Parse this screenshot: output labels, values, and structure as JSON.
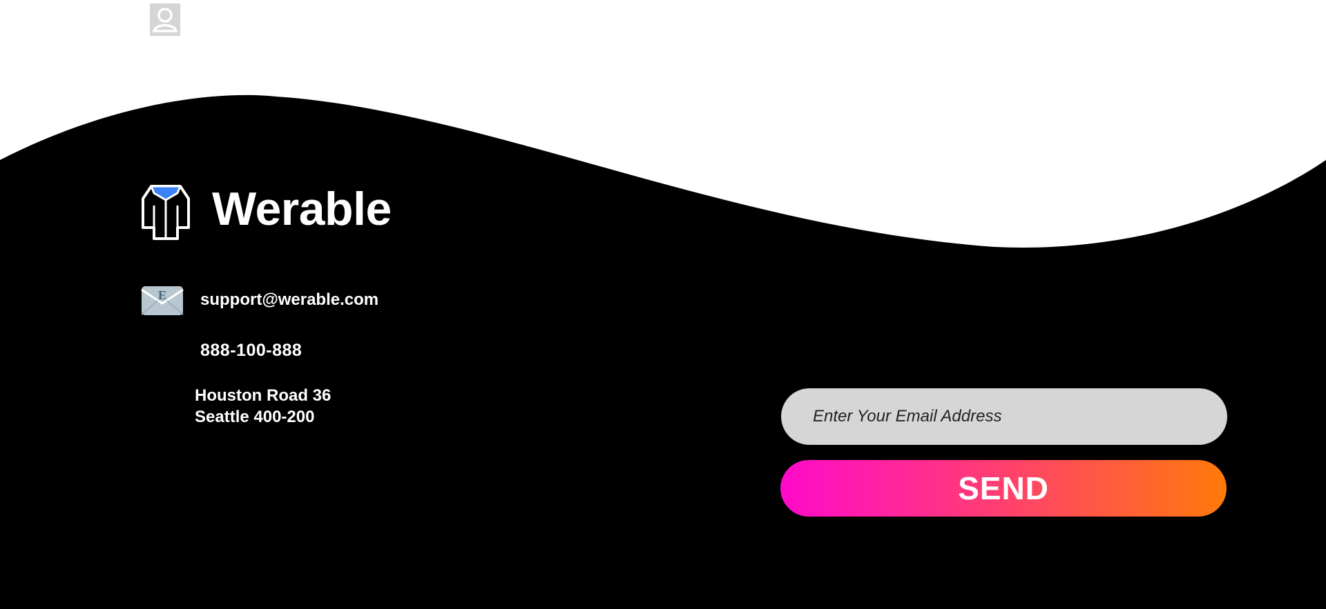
{
  "header": {
    "avatar_icon": "user-avatar-icon"
  },
  "footer": {
    "brand": {
      "logo_icon": "shirt-icon",
      "name": "Werable",
      "accent_color": "#3b82f6"
    },
    "contact": {
      "email_icon": "envelope-icon",
      "email": "support@werable.com",
      "phone": "888-100-888",
      "address_line1": "Houston Road 36",
      "address_line2": "Seattle 400-200"
    },
    "newsletter": {
      "email_placeholder": "Enter Your Email Address",
      "email_value": "",
      "send_label": "SEND",
      "send_gradient": [
        "#ff0acb",
        "#ff7a0a"
      ]
    },
    "background_color": "#000000"
  }
}
